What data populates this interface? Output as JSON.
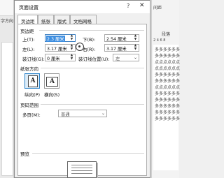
{
  "background_left": {
    "label": "字方向"
  },
  "background_right": {
    "top_label": "间距",
    "para_label": "段落",
    "ruler_text": "2 4 6 8",
    "doc_lines": [
      "多多多多多多",
      "多多多多多多",
      "点点点点点点",
      "点点点点点点",
      "多多多多多多",
      "多多多多多多",
      "点点点点点点",
      "多多多多多多",
      "多多多多多多",
      "多多多多多多",
      "多多多多多多",
      "多多多多多多"
    ]
  },
  "dialog": {
    "title": "页面设置",
    "help": "?",
    "close": "✕",
    "tabs": [
      "页边距",
      "纸张",
      "版式",
      "文档网格"
    ],
    "margins_section": "页边距",
    "top_label": "上(T):",
    "top_value": "2.3 厘米",
    "bottom_label": "下(B):",
    "bottom_value": "2.54 厘米",
    "left_label": "左(L):",
    "left_value": "3.17 厘米",
    "right_label": "右(R):",
    "right_value": "3.17 厘米",
    "gutter_label": "装订线(G):",
    "gutter_value": "0 厘米",
    "gutter_pos_label": "装订线位置(U):",
    "gutter_pos_value": "左",
    "orientation_section": "纸张方向",
    "portrait_label": "纵向(P)",
    "landscape_label": "横向(S)",
    "pages_section": "页码范围",
    "multi_pages_label": "多页(M):",
    "multi_pages_value": "普通",
    "preview_section": "预览"
  }
}
